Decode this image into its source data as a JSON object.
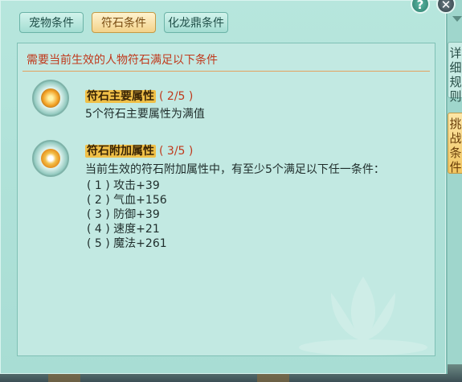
{
  "tabs": [
    {
      "label": "宠物条件",
      "active": false
    },
    {
      "label": "符石条件",
      "active": true
    },
    {
      "label": "化龙鼎条件",
      "active": false
    }
  ],
  "header": "需要当前生效的人物符石满足以下条件",
  "sections": [
    {
      "name": "符石主要属性",
      "count": "( 2/5 )",
      "lines": [
        "5个符石主要属性为满值"
      ]
    },
    {
      "name": "符石附加属性",
      "count": "( 3/5 )",
      "lines": [
        "当前生效的符石附加属性中，有至少5个满足以下任一条件：",
        "( 1 ) 攻击+39",
        "( 2 ) 气血+156",
        "( 3 ) 防御+39",
        "( 4 ) 速度+21",
        "( 5 ) 魔法+261"
      ]
    }
  ],
  "side_buttons": [
    "详细规则",
    "挑战条件"
  ],
  "top_buttons": {
    "help": "?",
    "close": "✕"
  },
  "colors": {
    "accent_red": "#c0391c",
    "active_tab": "#f3d28a",
    "panel_bg": "#c2e9e2"
  }
}
